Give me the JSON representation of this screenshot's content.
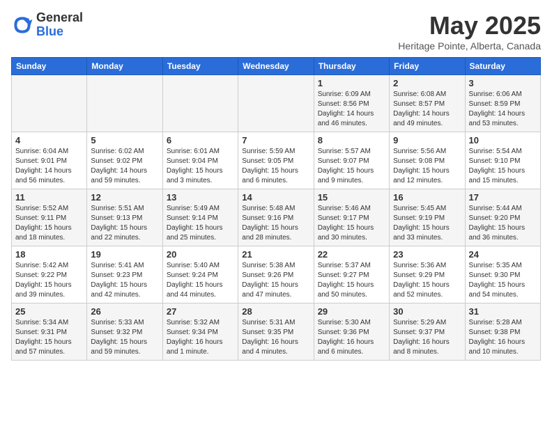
{
  "header": {
    "logo_general": "General",
    "logo_blue": "Blue",
    "month_title": "May 2025",
    "location": "Heritage Pointe, Alberta, Canada"
  },
  "days_of_week": [
    "Sunday",
    "Monday",
    "Tuesday",
    "Wednesday",
    "Thursday",
    "Friday",
    "Saturday"
  ],
  "weeks": [
    [
      {
        "day": "",
        "info": ""
      },
      {
        "day": "",
        "info": ""
      },
      {
        "day": "",
        "info": ""
      },
      {
        "day": "",
        "info": ""
      },
      {
        "day": "1",
        "info": "Sunrise: 6:09 AM\nSunset: 8:56 PM\nDaylight: 14 hours\nand 46 minutes."
      },
      {
        "day": "2",
        "info": "Sunrise: 6:08 AM\nSunset: 8:57 PM\nDaylight: 14 hours\nand 49 minutes."
      },
      {
        "day": "3",
        "info": "Sunrise: 6:06 AM\nSunset: 8:59 PM\nDaylight: 14 hours\nand 53 minutes."
      }
    ],
    [
      {
        "day": "4",
        "info": "Sunrise: 6:04 AM\nSunset: 9:01 PM\nDaylight: 14 hours\nand 56 minutes."
      },
      {
        "day": "5",
        "info": "Sunrise: 6:02 AM\nSunset: 9:02 PM\nDaylight: 14 hours\nand 59 minutes."
      },
      {
        "day": "6",
        "info": "Sunrise: 6:01 AM\nSunset: 9:04 PM\nDaylight: 15 hours\nand 3 minutes."
      },
      {
        "day": "7",
        "info": "Sunrise: 5:59 AM\nSunset: 9:05 PM\nDaylight: 15 hours\nand 6 minutes."
      },
      {
        "day": "8",
        "info": "Sunrise: 5:57 AM\nSunset: 9:07 PM\nDaylight: 15 hours\nand 9 minutes."
      },
      {
        "day": "9",
        "info": "Sunrise: 5:56 AM\nSunset: 9:08 PM\nDaylight: 15 hours\nand 12 minutes."
      },
      {
        "day": "10",
        "info": "Sunrise: 5:54 AM\nSunset: 9:10 PM\nDaylight: 15 hours\nand 15 minutes."
      }
    ],
    [
      {
        "day": "11",
        "info": "Sunrise: 5:52 AM\nSunset: 9:11 PM\nDaylight: 15 hours\nand 18 minutes."
      },
      {
        "day": "12",
        "info": "Sunrise: 5:51 AM\nSunset: 9:13 PM\nDaylight: 15 hours\nand 22 minutes."
      },
      {
        "day": "13",
        "info": "Sunrise: 5:49 AM\nSunset: 9:14 PM\nDaylight: 15 hours\nand 25 minutes."
      },
      {
        "day": "14",
        "info": "Sunrise: 5:48 AM\nSunset: 9:16 PM\nDaylight: 15 hours\nand 28 minutes."
      },
      {
        "day": "15",
        "info": "Sunrise: 5:46 AM\nSunset: 9:17 PM\nDaylight: 15 hours\nand 30 minutes."
      },
      {
        "day": "16",
        "info": "Sunrise: 5:45 AM\nSunset: 9:19 PM\nDaylight: 15 hours\nand 33 minutes."
      },
      {
        "day": "17",
        "info": "Sunrise: 5:44 AM\nSunset: 9:20 PM\nDaylight: 15 hours\nand 36 minutes."
      }
    ],
    [
      {
        "day": "18",
        "info": "Sunrise: 5:42 AM\nSunset: 9:22 PM\nDaylight: 15 hours\nand 39 minutes."
      },
      {
        "day": "19",
        "info": "Sunrise: 5:41 AM\nSunset: 9:23 PM\nDaylight: 15 hours\nand 42 minutes."
      },
      {
        "day": "20",
        "info": "Sunrise: 5:40 AM\nSunset: 9:24 PM\nDaylight: 15 hours\nand 44 minutes."
      },
      {
        "day": "21",
        "info": "Sunrise: 5:38 AM\nSunset: 9:26 PM\nDaylight: 15 hours\nand 47 minutes."
      },
      {
        "day": "22",
        "info": "Sunrise: 5:37 AM\nSunset: 9:27 PM\nDaylight: 15 hours\nand 50 minutes."
      },
      {
        "day": "23",
        "info": "Sunrise: 5:36 AM\nSunset: 9:29 PM\nDaylight: 15 hours\nand 52 minutes."
      },
      {
        "day": "24",
        "info": "Sunrise: 5:35 AM\nSunset: 9:30 PM\nDaylight: 15 hours\nand 54 minutes."
      }
    ],
    [
      {
        "day": "25",
        "info": "Sunrise: 5:34 AM\nSunset: 9:31 PM\nDaylight: 15 hours\nand 57 minutes."
      },
      {
        "day": "26",
        "info": "Sunrise: 5:33 AM\nSunset: 9:32 PM\nDaylight: 15 hours\nand 59 minutes."
      },
      {
        "day": "27",
        "info": "Sunrise: 5:32 AM\nSunset: 9:34 PM\nDaylight: 16 hours\nand 1 minute."
      },
      {
        "day": "28",
        "info": "Sunrise: 5:31 AM\nSunset: 9:35 PM\nDaylight: 16 hours\nand 4 minutes."
      },
      {
        "day": "29",
        "info": "Sunrise: 5:30 AM\nSunset: 9:36 PM\nDaylight: 16 hours\nand 6 minutes."
      },
      {
        "day": "30",
        "info": "Sunrise: 5:29 AM\nSunset: 9:37 PM\nDaylight: 16 hours\nand 8 minutes."
      },
      {
        "day": "31",
        "info": "Sunrise: 5:28 AM\nSunset: 9:38 PM\nDaylight: 16 hours\nand 10 minutes."
      }
    ]
  ]
}
